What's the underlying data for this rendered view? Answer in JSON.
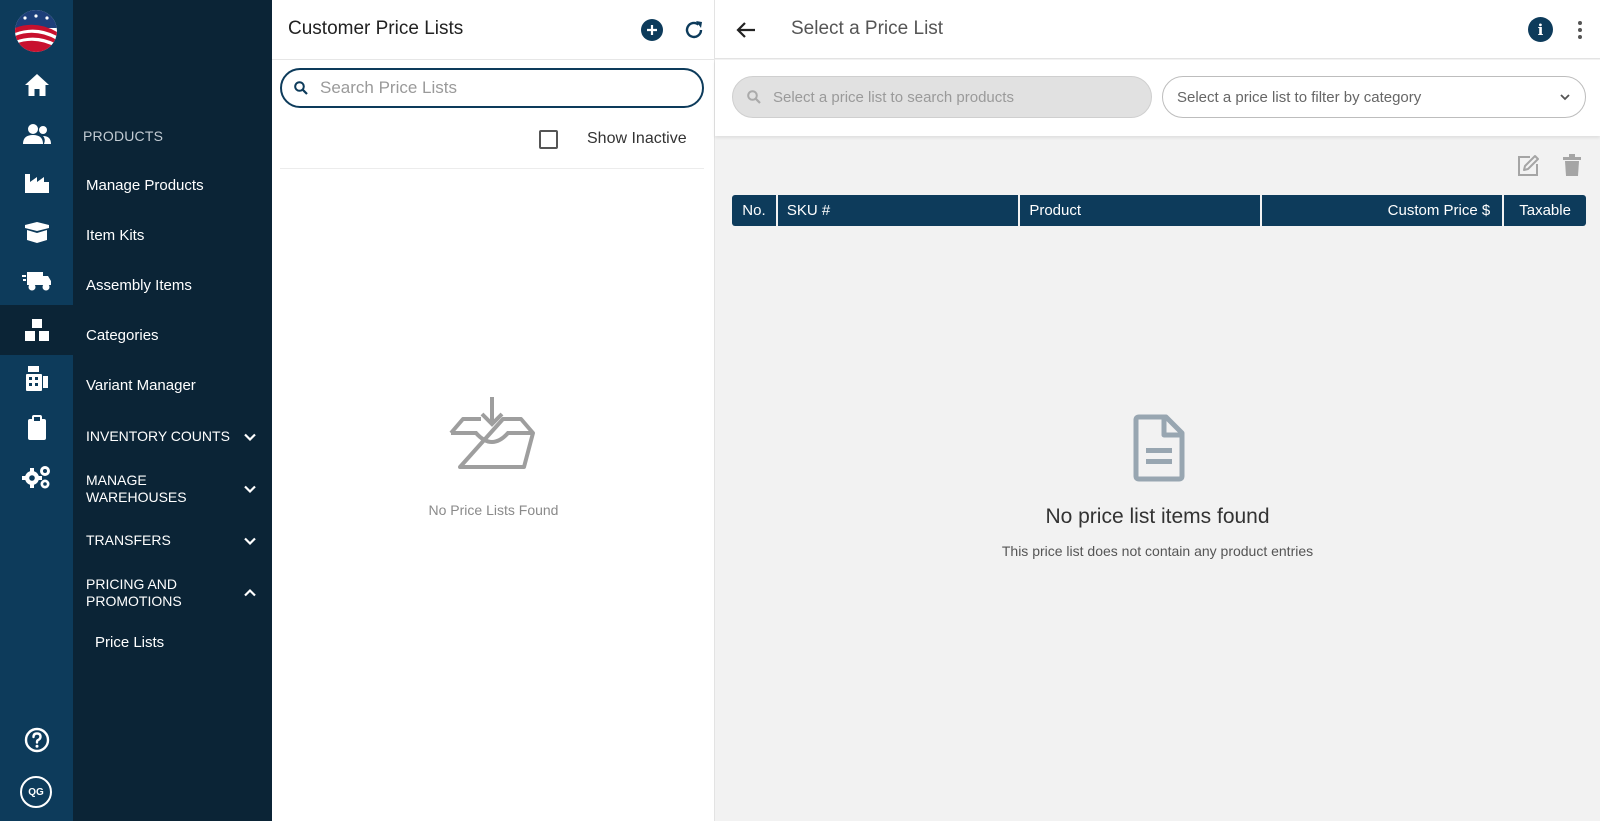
{
  "sidebar": {
    "section_label": "PRODUCTS",
    "items": [
      {
        "label": "Manage Products"
      },
      {
        "label": "Item Kits"
      },
      {
        "label": "Assembly Items"
      },
      {
        "label": "Categories"
      },
      {
        "label": "Variant Manager"
      }
    ],
    "groups": [
      {
        "label": "INVENTORY COUNTS",
        "expanded": false
      },
      {
        "label": "MANAGE WAREHOUSES",
        "expanded": false
      },
      {
        "label": "TRANSFERS",
        "expanded": false
      },
      {
        "label": "PRICING AND PROMOTIONS",
        "expanded": true
      }
    ],
    "sub_items": [
      {
        "label": "Price Lists"
      }
    ],
    "rail_icons": [
      "home-icon",
      "users-icon",
      "factory-icon",
      "box-icon",
      "truck-icon",
      "boxes-icon",
      "register-icon",
      "clipboard-icon",
      "gears-icon"
    ],
    "avatar_initials": "QG",
    "accent_color": "#0d3b5b",
    "menu_bg": "#0b2436"
  },
  "price_lists": {
    "title": "Customer Price Lists",
    "search_placeholder": "Search Price Lists",
    "show_inactive_label": "Show Inactive",
    "show_inactive_checked": false,
    "empty_text": "No Price Lists Found"
  },
  "main": {
    "title": "Select a Price List",
    "product_search_placeholder": "Select a price list to search products",
    "category_placeholder": "Select a price list to filter by category",
    "columns": [
      "No.",
      "SKU #",
      "Product",
      "Custom Price $",
      "Taxable"
    ],
    "empty_title": "No price list items found",
    "empty_subtitle": "This price list does not contain any product entries"
  }
}
